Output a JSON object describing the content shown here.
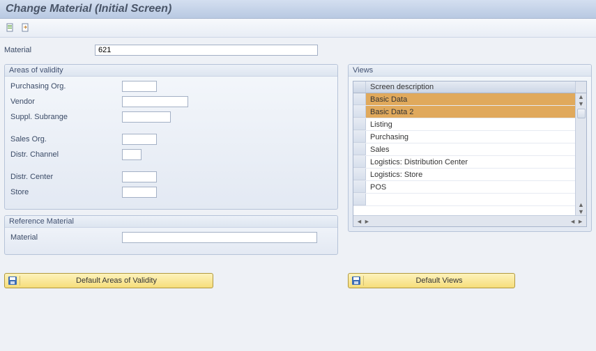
{
  "title": "Change Material (Initial Screen)",
  "toolbar": {
    "btn1_name": "select-views-icon",
    "btn2_name": "org-levels-icon"
  },
  "main": {
    "material_label": "Material",
    "material_value": "621"
  },
  "areas": {
    "panel_title": "Areas of validity",
    "purchasing_org_label": "Purchasing Org.",
    "purchasing_org_value": "",
    "vendor_label": "Vendor",
    "vendor_value": "",
    "suppl_subrange_label": "Suppl. Subrange",
    "suppl_subrange_value": "",
    "sales_org_label": "Sales Org.",
    "sales_org_value": "",
    "distr_channel_label": "Distr. Channel",
    "distr_channel_value": "",
    "distr_center_label": "Distr. Center",
    "distr_center_value": "",
    "store_label": "Store",
    "store_value": ""
  },
  "ref": {
    "panel_title": "Reference Material",
    "material_label": "Material",
    "material_value": ""
  },
  "views": {
    "panel_title": "Views",
    "header": "Screen description",
    "rows": [
      {
        "text": "Basic Data",
        "selected": true
      },
      {
        "text": "Basic Data 2",
        "selected": true
      },
      {
        "text": "Listing",
        "selected": false
      },
      {
        "text": "Purchasing",
        "selected": false
      },
      {
        "text": "Sales",
        "selected": false
      },
      {
        "text": "Logistics: Distribution Center",
        "selected": false
      },
      {
        "text": "Logistics: Store",
        "selected": false
      },
      {
        "text": "POS",
        "selected": false
      }
    ]
  },
  "buttons": {
    "default_areas": "Default Areas of Validity",
    "default_views": "Default Views"
  }
}
